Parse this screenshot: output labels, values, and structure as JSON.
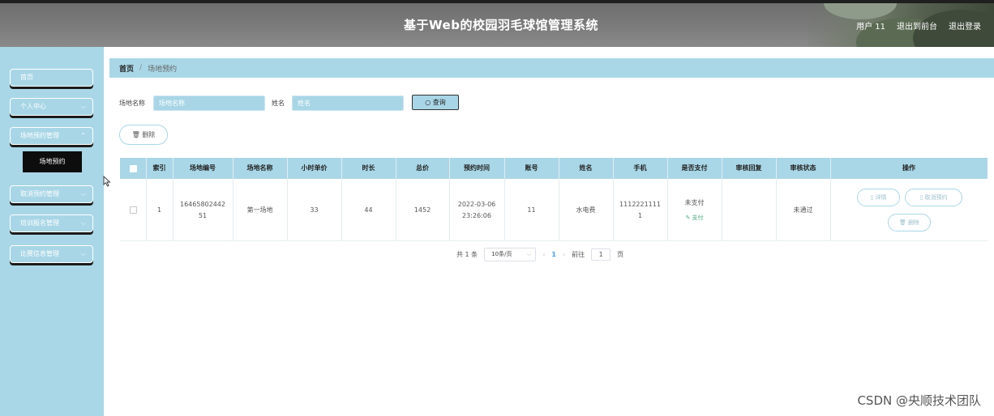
{
  "header": {
    "title": "基于Web的校园羽毛球馆管理系统",
    "user": "用户 11",
    "back_to_front": "退出到前台",
    "logout": "退出登录"
  },
  "sidebar": {
    "items": [
      {
        "label": "首页",
        "has_submenu": false
      },
      {
        "label": "个人中心",
        "has_submenu": true
      },
      {
        "label": "场地预约管理",
        "has_submenu": true
      },
      {
        "label": "取消预约管理",
        "has_submenu": true
      },
      {
        "label": "培训报名管理",
        "has_submenu": true
      },
      {
        "label": "比赛信息管理",
        "has_submenu": true
      }
    ],
    "active_subitem": "场地预约"
  },
  "breadcrumb": {
    "home": "首页",
    "separator": "/",
    "current": "场地预约"
  },
  "search": {
    "field1_label": "场地名称",
    "field1_placeholder": "场地名称",
    "field2_label": "姓名",
    "field2_placeholder": "姓名",
    "query_label": "查询"
  },
  "toolbar": {
    "delete_label": "删除"
  },
  "table": {
    "headers": [
      "索引",
      "场地编号",
      "场地名称",
      "小时单价",
      "时长",
      "总价",
      "预约时间",
      "账号",
      "姓名",
      "手机",
      "是否支付",
      "审核回复",
      "审核状态",
      "操作"
    ],
    "rows": [
      {
        "index": "1",
        "venue_no_line1": "16465802442",
        "venue_no_line2": "51",
        "venue_name": "第一场地",
        "hourly_price": "33",
        "duration": "44",
        "total": "1452",
        "time_line1": "2022-03-06",
        "time_line2": "23:26:06",
        "account": "11",
        "name": "水电费",
        "phone_line1": "1112221111",
        "phone_line2": "1",
        "paid": "未支付",
        "pay_action": "支付",
        "reply": "",
        "status": "未通过",
        "actions": {
          "detail": "详情",
          "cancel": "取消预约",
          "delete": "删除"
        }
      }
    ]
  },
  "pagination": {
    "total": "共 1 条",
    "page_size": "10条/页",
    "current_page": "1",
    "goto_label": "前往",
    "goto_value": "1",
    "page_suffix": "页"
  },
  "watermark": "CSDN @央顺技术团队",
  "colors": {
    "accent": "#a9d7e7",
    "header_bg": "#777777",
    "submenu_active_bg": "#0d0d0d",
    "pay_green": "#4cae7e"
  }
}
